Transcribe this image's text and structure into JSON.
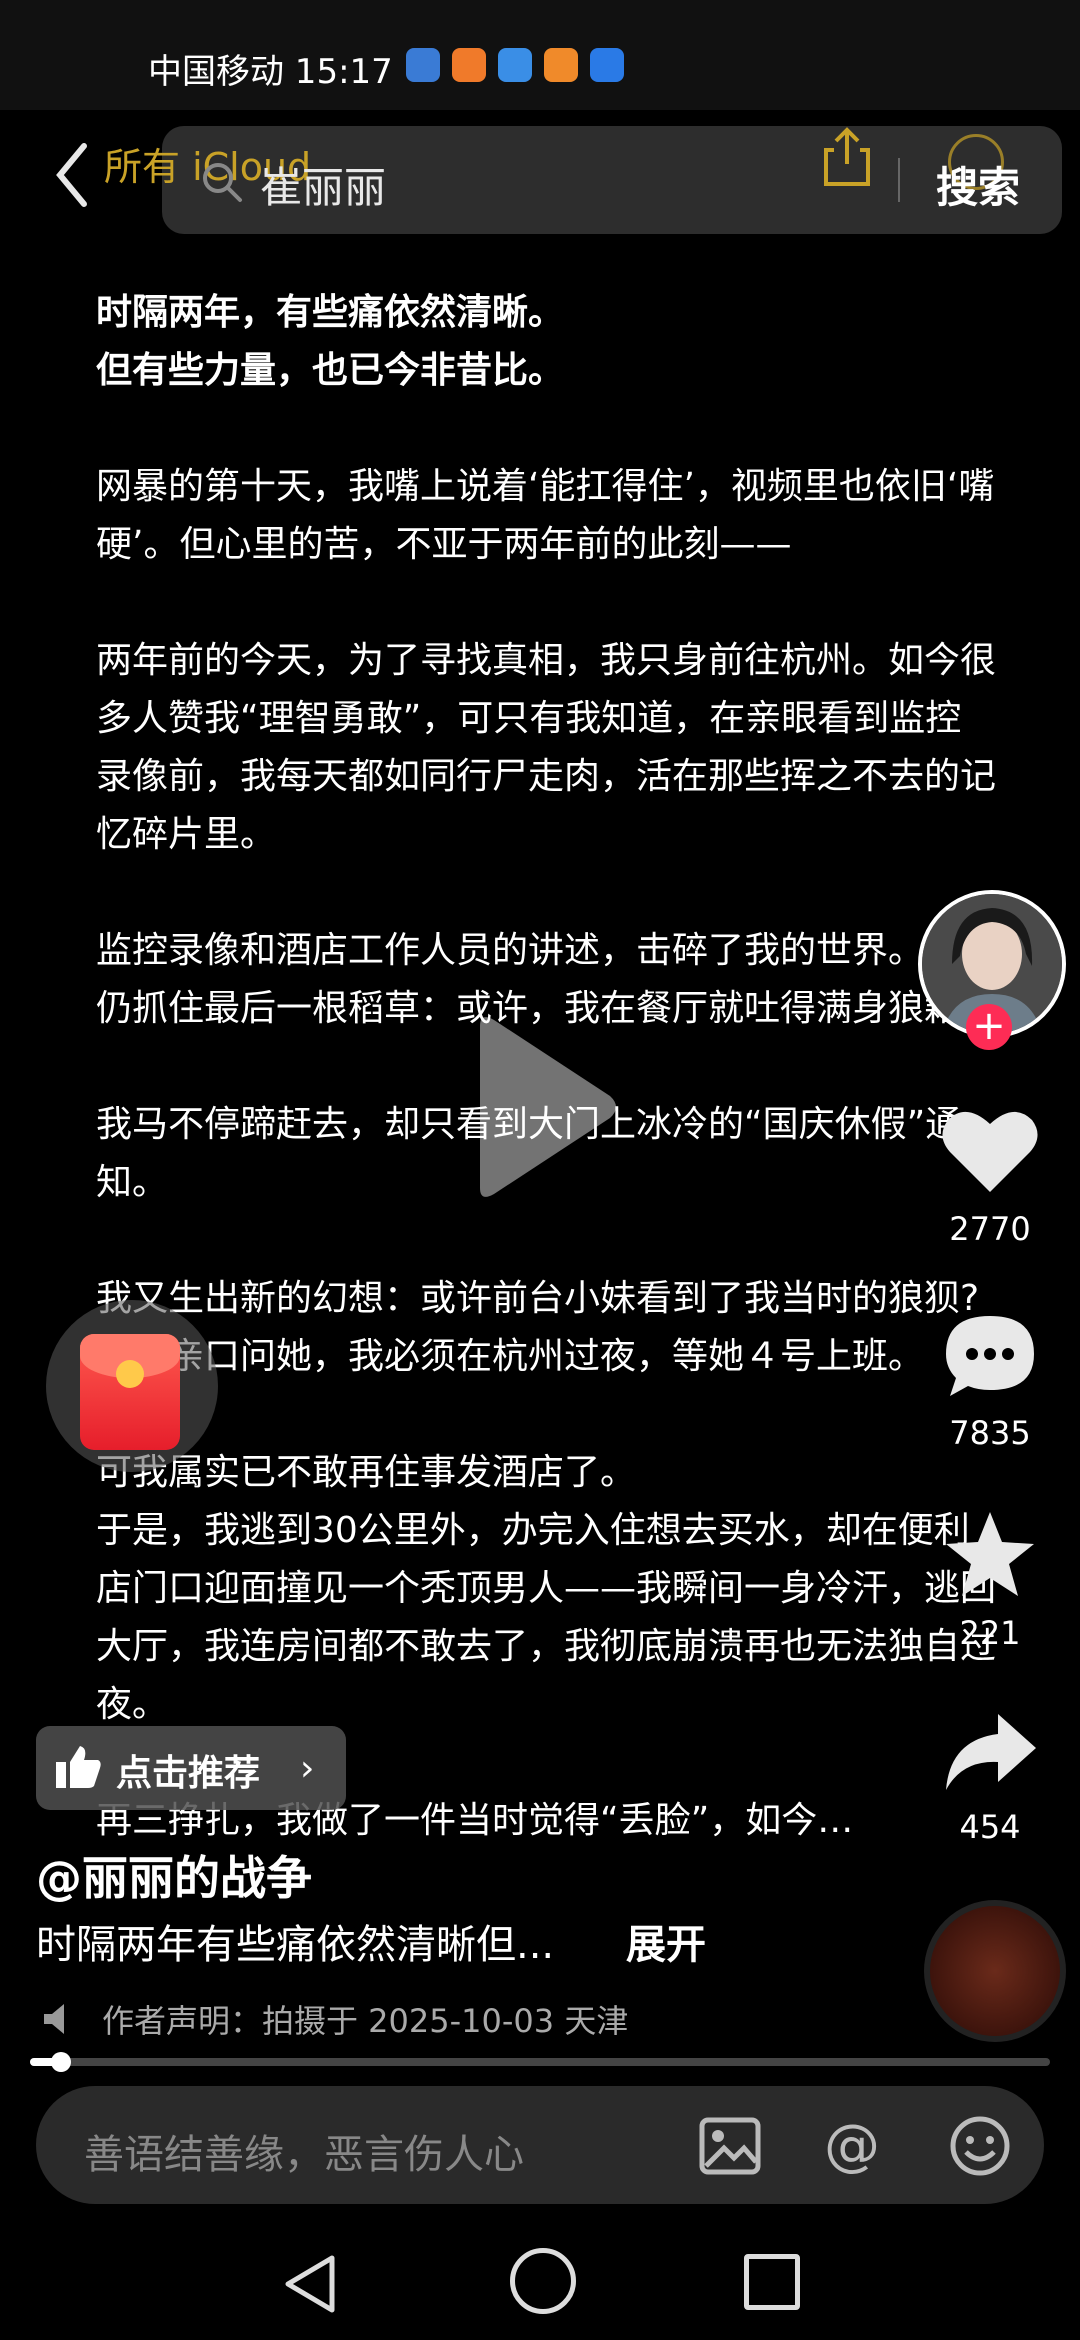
{
  "status_bar": {
    "carrier": "中国移动 15:17"
  },
  "header": {
    "back_label": "所有 iCloud",
    "search_value": "崔丽丽",
    "search_button": "搜索"
  },
  "article": {
    "paragraphs": [
      "时隔两年，有些痛依然清晰。\n但有些力量，也已今非昔比。",
      "网暴的第十天，我嘴上说着‘能扛得住’，视频里也依旧‘嘴硬’。但心里的苦，不亚于两年前的此刻——",
      "两年前的今天，为了寻找真相，我只身前往杭州。如今很多人赞我“理智勇敢”，可只有我知道，在亲眼看到监控录像前，我每天都如同行尸走肉，活在那些挥之不去的记忆碎片里。",
      "监控录像和酒店工作人员的讲述，击碎了我的世界。但我仍抓住最后一根稻草：或许，我在餐厅就吐得满身狼藉?",
      "我马不停蹄赶去，却只看到大门上冰冷的“国庆休假”通知。",
      "我又生出新的幻想：或许前台小妹看到了我当时的狼狈?为了亲口问她，我必须在杭州过夜，等她４号上班。",
      "可我属实已不敢再住事发酒店了。\n于是，我逃到30公里外，办完入住想去买水，却在便利店门口迎面撞见一个秃顶男人——我瞬间一身冷汗，逃回大厅，我连房间都不敢去了，我彻底崩溃再也无法独自过夜。",
      "再三挣扎，我做了一件当时觉得“丢脸”，如今…"
    ]
  },
  "sidebar": {
    "like_count": "2770",
    "comment_count": "7835",
    "favorite_count": "221",
    "share_count": "454"
  },
  "recommend": {
    "label": "点击推荐"
  },
  "post": {
    "author": "@丽丽的战争",
    "description": "时隔两年有些痛依然清晰但...",
    "expand_label": "展开",
    "declaration": "作者声明：拍摄于 2025-10-03 天津"
  },
  "progress": {
    "fraction": 0.03
  },
  "comment_bar": {
    "placeholder": "善语结善缘，恶言伤人心"
  },
  "colors": {
    "accent_gold": "#c9a227",
    "follow_red": "#fe2c55",
    "background": "#000000"
  }
}
